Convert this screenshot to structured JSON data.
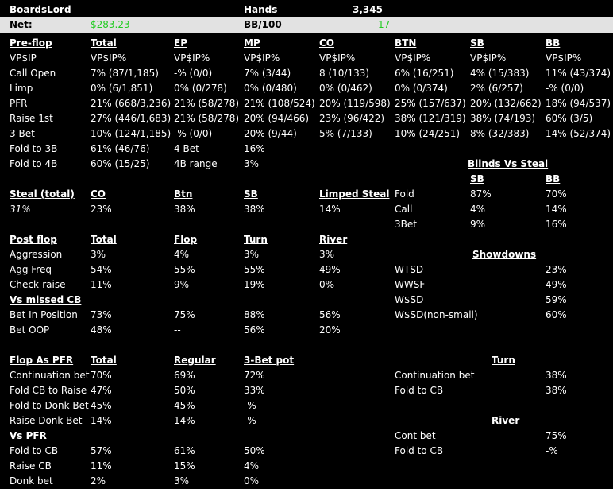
{
  "header": {
    "player": "BoardsLord",
    "hands_label": "Hands",
    "hands_value": "3,345",
    "net_label": "Net:",
    "net_value": "$283.23",
    "bb_label": "BB/100",
    "bb_value": "17"
  },
  "preflop": {
    "title": "Pre-flop",
    "columns": [
      "Total",
      "EP",
      "MP",
      "CO",
      "BTN",
      "SB",
      "BB"
    ],
    "rows": [
      {
        "label": "VP$IP",
        "values": [
          "VP$IP%",
          "VP$IP%",
          "VP$IP%",
          "VP$IP%",
          "VP$IP%",
          "VP$IP%",
          "VP$IP%"
        ]
      },
      {
        "label": "Call Open",
        "values": [
          "7% (87/1,185)",
          "-% (0/0)",
          "7% (3/44)",
          "8 (10/133)",
          "6% (16/251)",
          "4% (15/383)",
          "11% (43/374)"
        ]
      },
      {
        "label": "Limp",
        "values": [
          "0% (6/1,851)",
          "0% (0/278)",
          "0% (0/480)",
          "0% (0/462)",
          "0% (0/374)",
          "2% (6/257)",
          "-% (0/0)"
        ]
      },
      {
        "label": "PFR",
        "values": [
          "21% (668/3,236)",
          "21% (58/278)",
          "21% (108/524)",
          "20% (119/598)",
          "25% (157/637)",
          "20% (132/662)",
          "18% (94/537)"
        ]
      },
      {
        "label": "Raise 1st",
        "values": [
          "27% (446/1,683)",
          "21% (58/278)",
          "20% (94/466)",
          "23% (96/422)",
          "38% (121/319)",
          "38% (74/193)",
          "60% (3/5)"
        ]
      },
      {
        "label": "3-Bet",
        "values": [
          "10% (124/1,185)",
          "-% (0/0)",
          "20% (9/44)",
          "5% (7/133)",
          "10% (24/251)",
          "8% (32/383)",
          "14% (52/374)"
        ]
      }
    ],
    "fold3b_label": "Fold to 3B",
    "fold3b_value": "61% (46/76)",
    "bet4_label": "4-Bet",
    "bet4_value": "16%",
    "fold4b_label": "Fold to 4B",
    "fold4b_value": "60% (15/25)",
    "range4b_label": "4B range",
    "range4b_value": "3%"
  },
  "blinds_vs_steal": {
    "title": "Blinds Vs Steal",
    "col_sb": "SB",
    "col_bb": "BB",
    "rows": [
      {
        "label": "Fold",
        "sb": "87%",
        "bb": "70%"
      },
      {
        "label": "Call",
        "sb": "4%",
        "bb": "14%"
      },
      {
        "label": "3Bet",
        "sb": "9%",
        "bb": "16%"
      }
    ]
  },
  "steal": {
    "title": "Steal (total)",
    "total": "31%",
    "cols": [
      "CO",
      "Btn",
      "SB",
      "Limped Steal"
    ],
    "values": [
      "23%",
      "38%",
      "38%",
      "14%"
    ]
  },
  "postflop": {
    "title": "Post flop",
    "cols": [
      "Total",
      "Flop",
      "Turn",
      "River"
    ],
    "rows": [
      {
        "label": "Aggression",
        "values": [
          "3%",
          "4%",
          "3%",
          "3%"
        ]
      },
      {
        "label": "Agg Freq",
        "values": [
          "54%",
          "55%",
          "55%",
          "49%"
        ]
      },
      {
        "label": "Check-raise",
        "values": [
          "11%",
          "9%",
          "19%",
          "0%"
        ]
      }
    ],
    "vs_missed_title": "Vs missed CB",
    "vs_missed_rows": [
      {
        "label": "Bet In Position",
        "values": [
          "73%",
          "75%",
          "88%",
          "56%"
        ]
      },
      {
        "label": "Bet OOP",
        "values": [
          "48%",
          "--",
          "56%",
          "20%"
        ]
      }
    ]
  },
  "showdowns": {
    "title": "Showdowns",
    "rows": [
      {
        "label": "WTSD",
        "value": "23%"
      },
      {
        "label": "WWSF",
        "value": "49%"
      },
      {
        "label": "W$SD",
        "value": "59%"
      },
      {
        "label": "W$SD(non-small)",
        "value": "60%"
      }
    ]
  },
  "flop_as_pfr": {
    "title": "Flop As PFR",
    "cols": [
      "Total",
      "Regular",
      "3-Bet pot"
    ],
    "rows": [
      {
        "label": "Continuation bet",
        "values": [
          "70%",
          "69%",
          "72%"
        ]
      },
      {
        "label": "Fold CB to Raise",
        "values": [
          "47%",
          "50%",
          "33%"
        ]
      },
      {
        "label": "Fold to Donk Bet",
        "values": [
          "45%",
          "45%",
          "-%"
        ]
      },
      {
        "label": "Raise Donk Bet",
        "values": [
          "14%",
          "14%",
          "-%"
        ]
      }
    ],
    "vs_pfr_title": "Vs PFR",
    "vs_pfr_rows": [
      {
        "label": "Fold to CB",
        "values": [
          "57%",
          "61%",
          "50%"
        ]
      },
      {
        "label": "Raise CB",
        "values": [
          "11%",
          "15%",
          "4%"
        ]
      },
      {
        "label": "Donk bet",
        "values": [
          "2%",
          "3%",
          "0%"
        ]
      }
    ]
  },
  "turn": {
    "title": "Turn",
    "rows": [
      {
        "label": "Continuation bet",
        "value": "38%"
      },
      {
        "label": "Fold to CB",
        "value": "38%"
      }
    ]
  },
  "river": {
    "title": "River",
    "rows": [
      {
        "label": "Cont bet",
        "value": "75%"
      },
      {
        "label": "Fold to CB",
        "value": "-%"
      }
    ]
  }
}
